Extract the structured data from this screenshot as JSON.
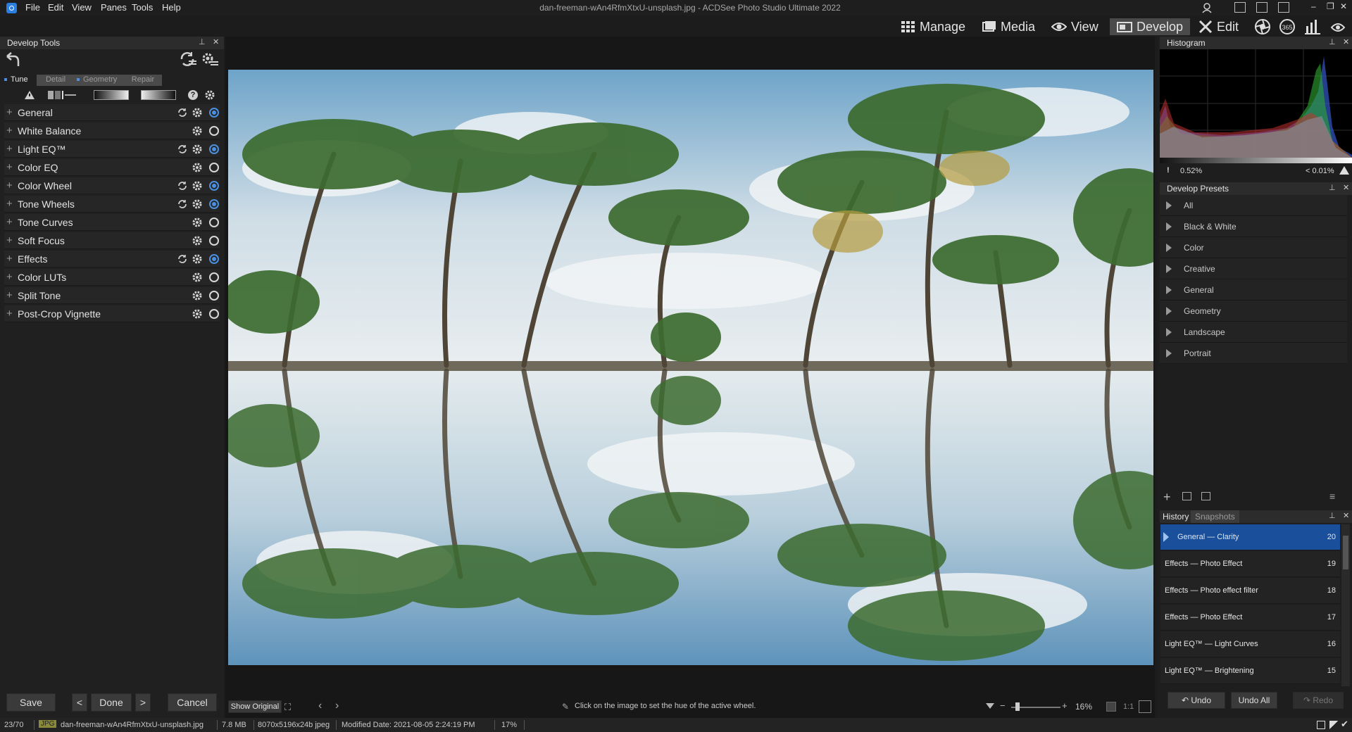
{
  "window": {
    "title": "dan-freeman-wAn4RfmXtxU-unsplash.jpg - ACDSee Photo Studio Ultimate 2022",
    "menu": [
      "File",
      "Edit",
      "View",
      "Panes",
      "Tools",
      "Help"
    ],
    "controls": [
      "–",
      "❐",
      "✕"
    ]
  },
  "modes": [
    {
      "label": "Manage",
      "icon": "grid-icon"
    },
    {
      "label": "Media",
      "icon": "media-icon"
    },
    {
      "label": "View",
      "icon": "eye-icon"
    },
    {
      "label": "Develop",
      "icon": "develop-icon",
      "active": true
    },
    {
      "label": "Edit",
      "icon": "edit-tools-icon"
    }
  ],
  "develop_tools": {
    "title": "Develop Tools",
    "tabs": [
      "Tune",
      "Detail",
      "Geometry",
      "Repair"
    ],
    "groups": [
      {
        "label": "General",
        "reset": true,
        "enabled": true
      },
      {
        "label": "White Balance",
        "reset": false,
        "enabled": false
      },
      {
        "label": "Light EQ™",
        "reset": true,
        "enabled": true
      },
      {
        "label": "Color EQ",
        "reset": false,
        "enabled": false
      },
      {
        "label": "Color Wheel",
        "reset": true,
        "enabled": true
      },
      {
        "label": "Tone Wheels",
        "reset": true,
        "enabled": true
      },
      {
        "label": "Tone Curves",
        "reset": false,
        "enabled": false
      },
      {
        "label": "Soft Focus",
        "reset": false,
        "enabled": false
      },
      {
        "label": "Effects",
        "reset": true,
        "enabled": true
      },
      {
        "label": "Color LUTs",
        "reset": false,
        "enabled": false
      },
      {
        "label": "Split Tone",
        "reset": false,
        "enabled": false
      },
      {
        "label": "Post-Crop Vignette",
        "reset": false,
        "enabled": false
      }
    ],
    "buttons": {
      "save": "Save",
      "prev": "<",
      "done": "Done",
      "next": ">",
      "cancel": "Cancel"
    }
  },
  "viewer": {
    "show_original": "Show Original",
    "hint": "Click on the image to set the hue of the active wheel.",
    "zoom": "16%",
    "ratio": "1:1"
  },
  "histogram": {
    "title": "Histogram",
    "low": "0.52%",
    "high": "< 0.01%"
  },
  "presets": {
    "title": "Develop Presets",
    "items": [
      "All",
      "Black & White",
      "Color",
      "Creative",
      "General",
      "Geometry",
      "Landscape",
      "Portrait"
    ]
  },
  "history": {
    "tabs": [
      "History",
      "Snapshots"
    ],
    "items": [
      {
        "label": "General — Clarity",
        "num": "20",
        "selected": true
      },
      {
        "label": "Effects — Photo Effect",
        "num": "19"
      },
      {
        "label": "Effects — Photo effect filter",
        "num": "18"
      },
      {
        "label": "Effects — Photo Effect",
        "num": "17"
      },
      {
        "label": "Light EQ™ — Light Curves",
        "num": "16"
      },
      {
        "label": "Light EQ™ — Brightening",
        "num": "15"
      }
    ],
    "buttons": {
      "undo": "Undo",
      "undo_all": "Undo All",
      "redo": "Redo"
    }
  },
  "status": {
    "index": "23/70",
    "format": "JPG",
    "filename": "dan-freeman-wAn4RfmXtxU-unsplash.jpg",
    "size": "7.8 MB",
    "dims": "8070x5196x24b jpeg",
    "modified": "Modified Date: 2021-08-05 2:24:19 PM",
    "zoom": "17%"
  }
}
